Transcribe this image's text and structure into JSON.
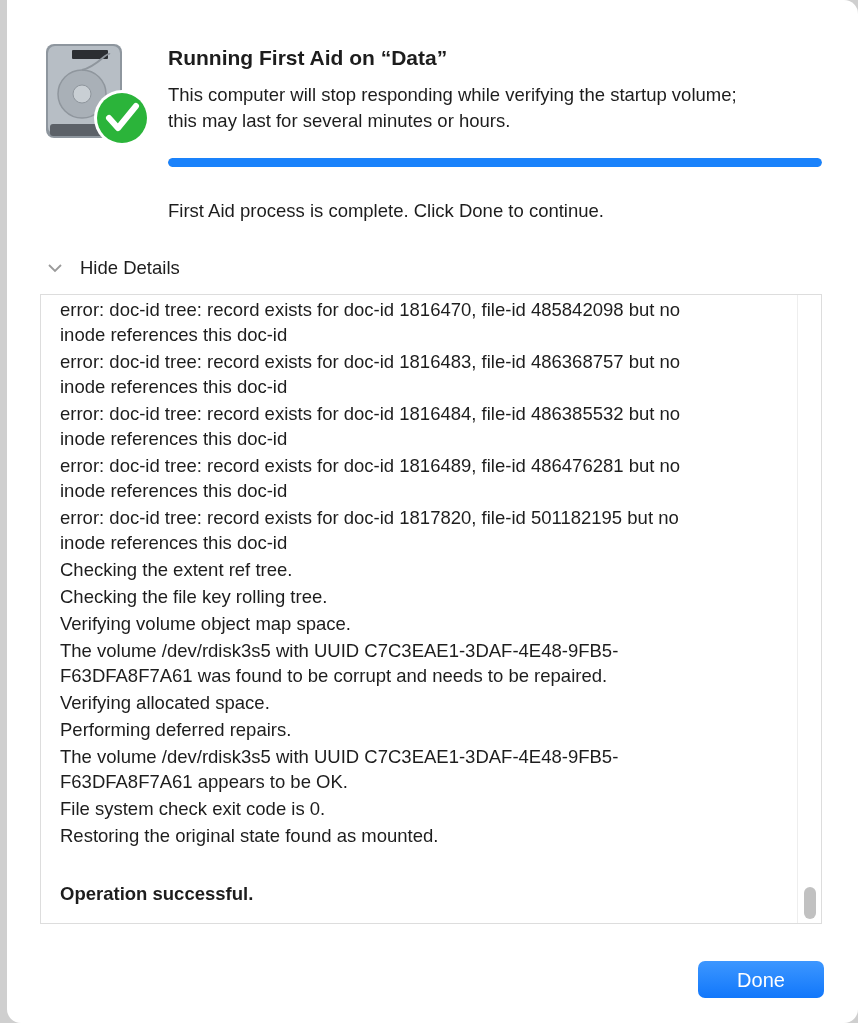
{
  "dialog": {
    "title": "Running First Aid on “Data”",
    "message": "This computer will stop responding while verifying the startup volume; this may last for several minutes or hours.",
    "progress": {
      "level": 1
    },
    "status": "First Aid process is complete. Click Done to continue.",
    "details_toggle": {
      "label": "Hide Details",
      "expanded": true
    },
    "log": [
      {
        "text": "error: doc-id tree: record exists for doc-id 1816470, file-id 485842098 but no inode references this doc-id",
        "bold": false
      },
      {
        "text": "error: doc-id tree: record exists for doc-id 1816483, file-id 486368757 but no inode references this doc-id",
        "bold": false
      },
      {
        "text": "error: doc-id tree: record exists for doc-id 1816484, file-id 486385532 but no inode references this doc-id",
        "bold": false
      },
      {
        "text": "error: doc-id tree: record exists for doc-id 1816489, file-id 486476281 but no inode references this doc-id",
        "bold": false
      },
      {
        "text": "error: doc-id tree: record exists for doc-id 1817820, file-id 501182195 but no inode references this doc-id",
        "bold": false
      },
      {
        "text": "Checking the extent ref tree.",
        "bold": false
      },
      {
        "text": "Checking the file key rolling tree.",
        "bold": false
      },
      {
        "text": "Verifying volume object map space.",
        "bold": false
      },
      {
        "text": "The volume /dev/rdisk3s5 with UUID C7C3EAE1-3DAF-4E48-9FB5-F63DFA8F7A61 was found to be corrupt and needs to be repaired.",
        "bold": false
      },
      {
        "text": "Verifying allocated space.",
        "bold": false
      },
      {
        "text": "Performing deferred repairs.",
        "bold": false
      },
      {
        "text": "The volume /dev/rdisk3s5 with UUID C7C3EAE1-3DAF-4E48-9FB5-F63DFA8F7A61 appears to be OK.",
        "bold": false
      },
      {
        "text": "File system check exit code is 0.",
        "bold": false
      },
      {
        "text": "Restoring the original state found as mounted.",
        "bold": false
      },
      {
        "text": "Operation successful.",
        "bold": true,
        "gap_before": true
      }
    ],
    "buttons": [
      {
        "label": "Done",
        "default": true
      }
    ]
  }
}
